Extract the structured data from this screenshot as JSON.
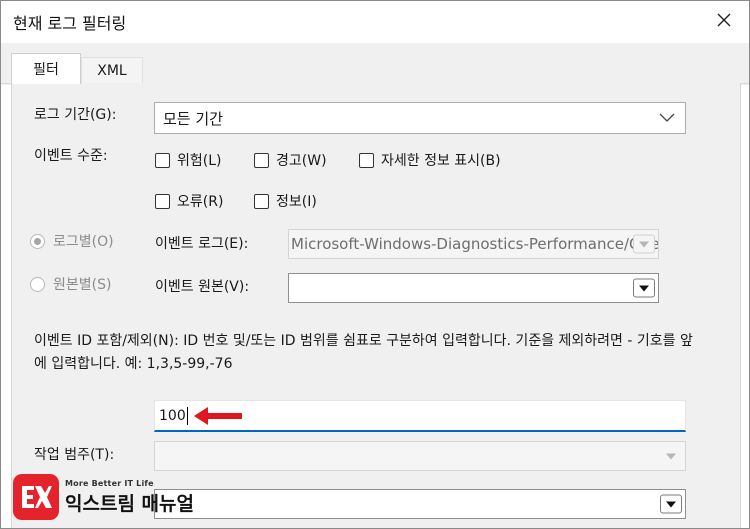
{
  "dialog": {
    "title": "현재 로그 필터링"
  },
  "tabs": [
    {
      "label": "필터",
      "active": true
    },
    {
      "label": "XML",
      "active": false
    }
  ],
  "filter": {
    "log_period_label": "로그 기간(G):",
    "log_period_value": "모든 기간",
    "event_level_label": "이벤트 수준:",
    "levels": [
      {
        "label": "위험(L)",
        "checked": false
      },
      {
        "label": "경고(W)",
        "checked": false
      },
      {
        "label": "자세한 정보 표시(B)",
        "checked": false
      },
      {
        "label": "오류(R)",
        "checked": false
      },
      {
        "label": "정보(I)",
        "checked": false
      }
    ],
    "by_log_label": "로그별(O)",
    "by_source_label": "원본별(S)",
    "event_log_label": "이벤트 로그(E):",
    "event_log_value": "Microsoft-Windows-Diagnostics-Performance/Operational",
    "event_source_label": "이벤트 원본(V):",
    "event_source_value": "",
    "event_id_description": "이벤트 ID 포함/제외(N): ID 번호 및/또는 ID 범위를 쉼표로 구분하여 입력합니다. 기준을 제외하려면 - 기호를 앞에 입력합니다. 예: 1,3,5-99,-76",
    "event_id_value": "100",
    "task_category_label": "작업 범주(T):",
    "task_category_value": "",
    "keywords_value": ""
  },
  "branding": {
    "tagline": "More Better IT Life",
    "name": "익스트림 매뉴얼",
    "color": "#e5232c"
  },
  "colors": {
    "accent": "#0067c0",
    "annotation_arrow": "#e0161e"
  }
}
